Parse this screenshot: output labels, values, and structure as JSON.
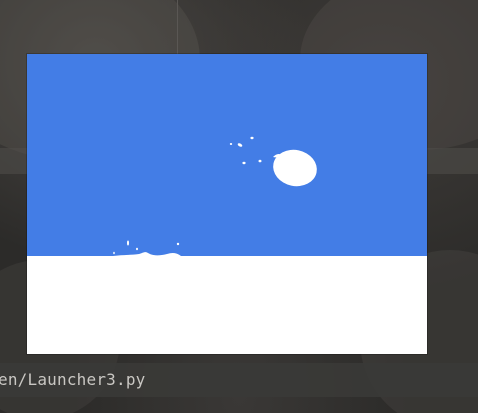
{
  "terminal": {
    "path_text": "en/Launcher3.py"
  },
  "game": {
    "sky_color": "#437DE6",
    "ground_color": "#FFFFFF",
    "drop_color": "#FFFFFF"
  },
  "background": {
    "base_color": "#2C2B29",
    "strip_color": "#3A3937"
  }
}
